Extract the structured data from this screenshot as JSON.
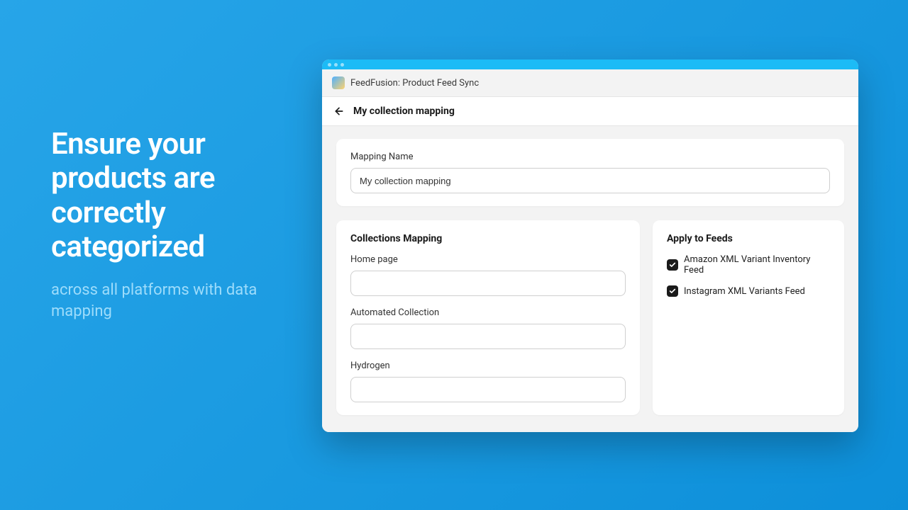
{
  "hero": {
    "headline": "Ensure your products are correctly categorized",
    "subline": "across all platforms with data mapping"
  },
  "app": {
    "title": "FeedFusion: Product Feed Sync"
  },
  "page": {
    "title": "My collection mapping"
  },
  "mapping_name": {
    "label": "Mapping Name",
    "value": "My collection mapping"
  },
  "collections": {
    "title": "Collections Mapping",
    "items": [
      {
        "label": "Home page",
        "value": ""
      },
      {
        "label": "Automated Collection",
        "value": ""
      },
      {
        "label": "Hydrogen",
        "value": ""
      }
    ]
  },
  "feeds": {
    "title": "Apply to Feeds",
    "items": [
      {
        "label": "Amazon XML Variant Inventory Feed",
        "checked": true
      },
      {
        "label": "Instagram XML Variants Feed",
        "checked": true
      }
    ]
  }
}
